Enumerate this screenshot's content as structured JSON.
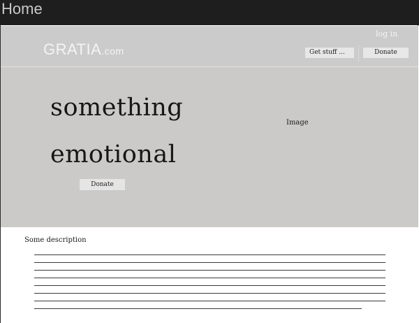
{
  "window": {
    "title": "Home"
  },
  "header": {
    "logo_main": "GRATIA",
    "logo_sub": ".com",
    "login_label": "log in",
    "getstuff_label": "Get stuff ...",
    "donate_label": "Donate"
  },
  "hero": {
    "line1": "something",
    "line2": "emotional",
    "donate_label": "Donate",
    "image_label": "Image"
  },
  "content": {
    "heading": "Some description"
  },
  "colors": {
    "titlebar": "#1e1e1e",
    "header_bg": "#cbcbcb",
    "hero_bg": "#cbcac8",
    "button_bg": "#e7e7e7"
  }
}
